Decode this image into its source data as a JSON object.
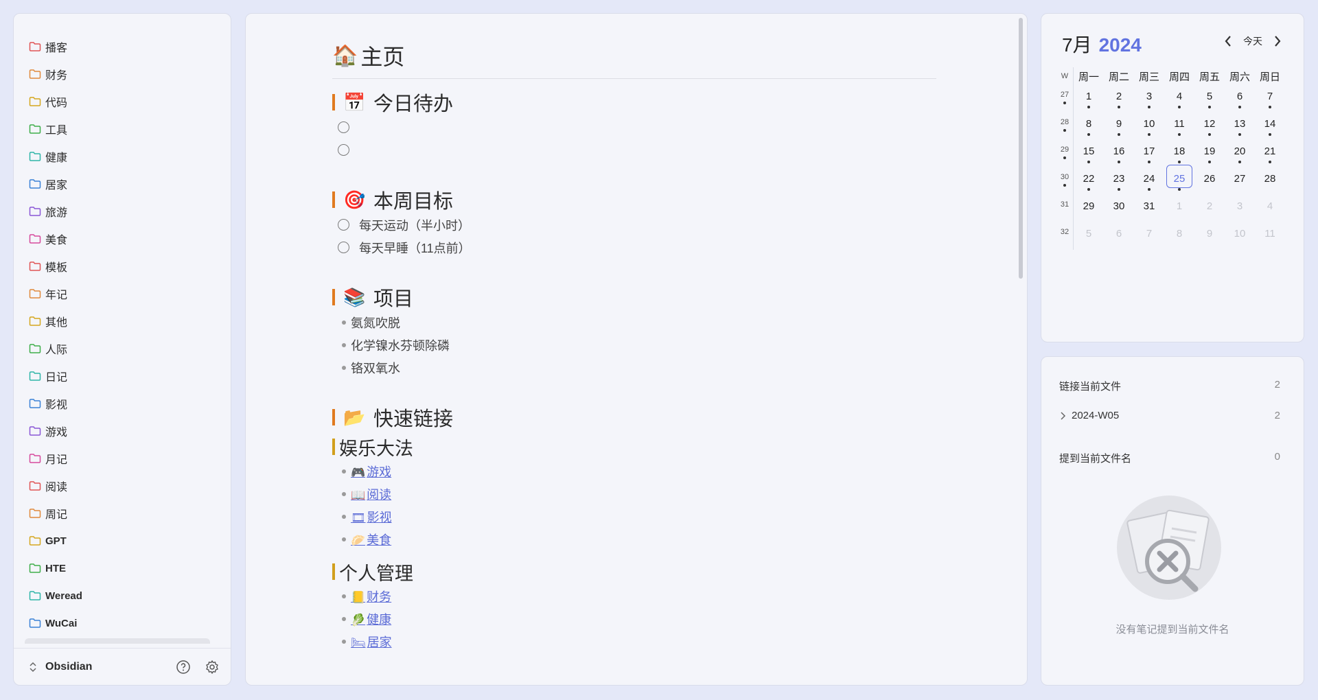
{
  "sidebar": {
    "folders": [
      {
        "label": "播客",
        "color": "#e05555"
      },
      {
        "label": "财务",
        "color": "#e08a3c"
      },
      {
        "label": "代码",
        "color": "#d5a71e"
      },
      {
        "label": "工具",
        "color": "#3fae4a"
      },
      {
        "label": "健康",
        "color": "#2fb5a8"
      },
      {
        "label": "居家",
        "color": "#3b82d6"
      },
      {
        "label": "旅游",
        "color": "#8a56d6"
      },
      {
        "label": "美食",
        "color": "#d64a9c"
      },
      {
        "label": "模板",
        "color": "#e05555"
      },
      {
        "label": "年记",
        "color": "#e08a3c"
      },
      {
        "label": "其他",
        "color": "#d5a71e"
      },
      {
        "label": "人际",
        "color": "#3fae4a"
      },
      {
        "label": "日记",
        "color": "#2fb5a8"
      },
      {
        "label": "影视",
        "color": "#3b82d6"
      },
      {
        "label": "游戏",
        "color": "#8a56d6"
      },
      {
        "label": "月记",
        "color": "#d64a9c"
      },
      {
        "label": "阅读",
        "color": "#e05555"
      },
      {
        "label": "周记",
        "color": "#e08a3c"
      },
      {
        "label": "GPT",
        "color": "#d5a71e"
      },
      {
        "label": "HTE",
        "color": "#3fae4a"
      },
      {
        "label": "Weread",
        "color": "#2fb5a8"
      },
      {
        "label": "WuCai",
        "color": "#3b82d6"
      }
    ],
    "active_file": "🏠主页",
    "vault_name": "Obsidian",
    "help_icon": "help-circle-icon",
    "settings_icon": "gear-icon"
  },
  "note": {
    "title": "主页",
    "title_emoji": "🏠",
    "sections": {
      "todo": {
        "emoji": "📅",
        "heading": "今日待办"
      },
      "weekly": {
        "emoji": "🎯",
        "heading": "本周目标",
        "tasks": [
          "每天运动（半小时）",
          "每天早睡（11点前）"
        ]
      },
      "projects": {
        "emoji": "📚",
        "heading": "项目",
        "items": [
          "氨氮吹脱",
          "化学镍水芬顿除磷",
          "铬双氧水"
        ]
      },
      "quick": {
        "emoji": "📂",
        "heading": "快速链接"
      },
      "fun": {
        "heading": "娱乐大法",
        "links": [
          {
            "emoji": "🎮",
            "label": "游戏"
          },
          {
            "emoji": "📖",
            "label": "阅读"
          },
          {
            "emoji": "🎞",
            "label": "影视"
          },
          {
            "emoji": "🥟",
            "label": "美食"
          }
        ]
      },
      "personal": {
        "heading": "个人管理",
        "links": [
          {
            "emoji": "📒",
            "label": "财务"
          },
          {
            "emoji": "🥬",
            "label": "健康"
          },
          {
            "emoji": "🛏",
            "label": "居家"
          }
        ]
      }
    }
  },
  "calendar": {
    "month": "7月",
    "year": "2024",
    "today_label": "今天",
    "week_col": "W",
    "weekdays": [
      "周一",
      "周二",
      "周三",
      "周四",
      "周五",
      "周六",
      "周日"
    ],
    "weeks": [
      {
        "w": "27",
        "days": [
          {
            "d": "1",
            "dot": true
          },
          {
            "d": "2",
            "dot": true
          },
          {
            "d": "3",
            "dot": true
          },
          {
            "d": "4",
            "dot": true
          },
          {
            "d": "5",
            "dot": true
          },
          {
            "d": "6",
            "dot": true
          },
          {
            "d": "7",
            "dot": true
          }
        ],
        "wdot": true
      },
      {
        "w": "28",
        "days": [
          {
            "d": "8",
            "dot": true
          },
          {
            "d": "9",
            "dot": true
          },
          {
            "d": "10",
            "dot": true
          },
          {
            "d": "11",
            "dot": true
          },
          {
            "d": "12",
            "dot": true
          },
          {
            "d": "13",
            "dot": true
          },
          {
            "d": "14",
            "dot": true
          }
        ],
        "wdot": true
      },
      {
        "w": "29",
        "days": [
          {
            "d": "15",
            "dot": true
          },
          {
            "d": "16",
            "dot": true
          },
          {
            "d": "17",
            "dot": true
          },
          {
            "d": "18",
            "dot": true
          },
          {
            "d": "19",
            "dot": true
          },
          {
            "d": "20",
            "dot": true
          },
          {
            "d": "21",
            "dot": true
          }
        ],
        "wdot": true
      },
      {
        "w": "30",
        "days": [
          {
            "d": "22",
            "dot": true
          },
          {
            "d": "23",
            "dot": true
          },
          {
            "d": "24",
            "dot": true
          },
          {
            "d": "25",
            "dot": true,
            "today": true
          },
          {
            "d": "26"
          },
          {
            "d": "27"
          },
          {
            "d": "28"
          }
        ],
        "wdot": true
      },
      {
        "w": "31",
        "days": [
          {
            "d": "29"
          },
          {
            "d": "30"
          },
          {
            "d": "31"
          },
          {
            "d": "1",
            "other": true
          },
          {
            "d": "2",
            "other": true
          },
          {
            "d": "3",
            "other": true
          },
          {
            "d": "4",
            "other": true
          }
        ]
      },
      {
        "w": "32",
        "days": [
          {
            "d": "5",
            "other": true
          },
          {
            "d": "6",
            "other": true
          },
          {
            "d": "7",
            "other": true
          },
          {
            "d": "8",
            "other": true
          },
          {
            "d": "9",
            "other": true
          },
          {
            "d": "10",
            "other": true
          },
          {
            "d": "11",
            "other": true
          }
        ]
      }
    ]
  },
  "backlinks": {
    "linked_label": "链接当前文件",
    "linked_count": "2",
    "child_label": "2024-W05",
    "child_count": "2",
    "unlinked_label": "提到当前文件名",
    "unlinked_count": "0",
    "empty_text": "没有笔记提到当前文件名"
  }
}
